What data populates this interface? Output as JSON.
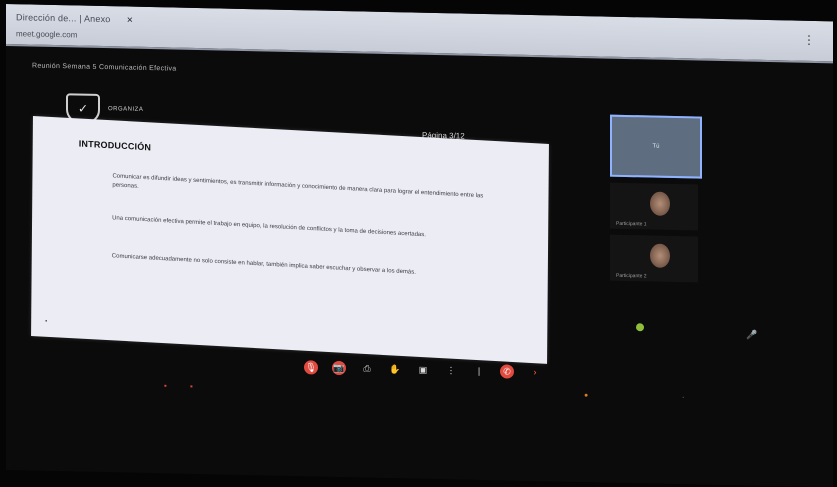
{
  "browser": {
    "tab_text": "Dirección de... | Anexo",
    "close_glyph": "✕",
    "url_text": "meet.google.com",
    "menu_glyph": "⋮"
  },
  "meeting": {
    "title": "Reunión Semana 5 Comunicación Efectiva",
    "logo_glyph": "✓",
    "logo_text": "ORGANIZA",
    "page_indicator": "Página 3/12"
  },
  "slide": {
    "title": "INTRODUCCIÓN",
    "paragraphs": [
      "Comunicar es difundir ideas y sentimientos, es transmitir información y conocimiento de manera clara para lograr el entendimiento entre las personas.",
      "Una comunicación efectiva permite el trabajo en equipo, la resolución de conflictos y la toma de decisiones acertadas.",
      "Comunicarse adecuadamente no solo consiste en hablar, también implica saber escuchar y observar a los demás."
    ],
    "corner_mark": "•"
  },
  "participants": {
    "self_label": "Tú",
    "tile1_name": "Participante 1",
    "tile2_name": "Participante 2",
    "mic_glyph": "🎤"
  },
  "toolbar": {
    "mic_glyph": "🎙",
    "cam_glyph": "📷",
    "cc_glyph": "⎙",
    "hand_glyph": "✋",
    "present_glyph": "▣",
    "more_glyph": "⋮",
    "end_glyph": "✆",
    "pipe_glyph": "|",
    "chev_glyph": "›"
  },
  "side": {
    "left_a": "▪",
    "left_b": "▪",
    "right_orange": "●",
    "right_dot": "·"
  },
  "colors": {
    "end_call": "#e14a3f",
    "active_border": "#8fb3ff",
    "status_green": "#8fbf3a"
  }
}
